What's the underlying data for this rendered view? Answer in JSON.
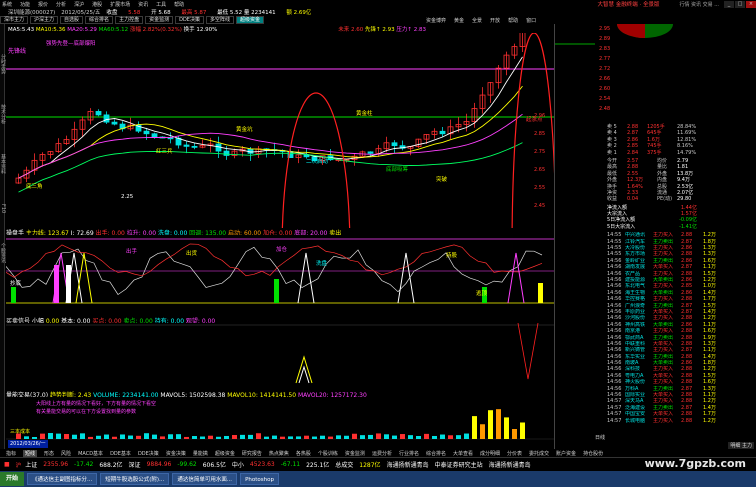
{
  "titlebar": {
    "menu_items": [
      "系统",
      "功能",
      "报价",
      "分析",
      "深沪",
      "港股",
      "扩展市场",
      "资讯",
      "工具",
      "帮助"
    ],
    "title": "大智慧 金融终端 · 全景版",
    "top_right": "行情 资讯 交易 ...",
    "minimize": "_",
    "maximize": "□",
    "close": "×"
  },
  "toolbar": {
    "tabs": [
      "深市主力",
      "沪深主力",
      "自选股",
      "综合排名",
      "主力控盘",
      "资金监测",
      "DDE决策",
      "多空阵线",
      "超级资金"
    ],
    "active_index": 8,
    "right_items": [
      "资金博弈",
      "黄金",
      "全景",
      "开放",
      "帮助",
      "窗口"
    ]
  },
  "lefttabs": [
    "分时走势",
    "技术分析",
    "基本资料",
    "F10",
    "个股资讯"
  ],
  "stock": {
    "code_name": "深圳能源(000027)",
    "date": "2012/05/25/五",
    "line1_parts": [
      {
        "text": "收盘 ",
        "color": "white"
      },
      {
        "text": "5.58",
        "color": "red"
      },
      {
        "text": "  开 5.68 ",
        "color": "white"
      },
      {
        "text": "最高 5.87",
        "color": "red"
      },
      {
        "text": "  最低 5.52  量 2234141  ",
        "color": "white"
      },
      {
        "text": "额 2.69亿",
        "color": "yellow"
      }
    ],
    "line2_parts": [
      {
        "text": "MA5:5.43 ",
        "color": "white"
      },
      {
        "text": "MA10:5.36 ",
        "color": "yellow"
      },
      {
        "text": "MA20:5.29 ",
        "color": "magenta"
      },
      {
        "text": "MA60:5.12 ",
        "color": "green"
      },
      {
        "text": "涨幅 2.82%(0.32%) ",
        "color": "red"
      },
      {
        "text": "换手 12.90%",
        "color": "white"
      }
    ],
    "header_right_parts": [
      {
        "text": "未来 2.60",
        "color": "red"
      },
      {
        "text": "  先锋↑ 2.93",
        "color": "yellow"
      },
      {
        "text": "  压力↑ 2.83",
        "color": "magenta"
      }
    ],
    "line_label_left": "先锋线",
    "price_labels": [
      "2.96",
      "2.85",
      "2.75",
      "2.65",
      "2.55",
      "2.45"
    ],
    "annotations": [
      {
        "text": "强势先登—底部爆阳",
        "color": "magenta"
      },
      {
        "text": "底三角",
        "color": "yellow"
      },
      {
        "text": "红三兵",
        "color": "yellow"
      },
      {
        "text": "黄金坑",
        "color": "yellow"
      },
      {
        "text": "二次启动",
        "color": "cyan"
      },
      {
        "text": "突破",
        "color": "yellow"
      },
      {
        "text": "2.25",
        "color": "white"
      },
      {
        "text": "底部吸筹",
        "color": "green"
      },
      {
        "text": "黄金柱",
        "color": "yellow"
      },
      {
        "text": "起涨点",
        "color": "red"
      }
    ]
  },
  "indicator1": {
    "header_parts": [
      {
        "text": "操盘手 ",
        "color": "white"
      },
      {
        "text": "主力线: 123.67  ",
        "color": "yellow"
      },
      {
        "text": "J: 72.69  ",
        "color": "white"
      },
      {
        "text": "出手: 0.00  ",
        "color": "red"
      },
      {
        "text": "拉升: 0.00  ",
        "color": "magenta"
      },
      {
        "text": "洗盘: 0.00  ",
        "color": "cyan"
      },
      {
        "text": "回调: 135.00  ",
        "color": "green"
      },
      {
        "text": "启动: 60.00  ",
        "color": "orange"
      },
      {
        "text": "加仓: 0.00  ",
        "color": "red"
      },
      {
        "text": "底部: 20.00  ",
        "color": "magenta"
      },
      {
        "text": "卖出",
        "color": "yellow"
      }
    ],
    "labels": [
      {
        "text": "抄底",
        "color": "white"
      },
      {
        "text": "出手",
        "color": "magenta"
      },
      {
        "text": "出货",
        "color": "yellow"
      },
      {
        "text": "加仓",
        "color": "magenta"
      },
      {
        "text": "洗盘",
        "color": "cyan"
      },
      {
        "text": "持股",
        "color": "yellow"
      },
      {
        "text": "逃顶",
        "color": "yellow"
      }
    ]
  },
  "indicator2": {
    "header_parts": [
      {
        "text": "买卖信号 小幅 ",
        "color": "white"
      },
      {
        "text": "0.00 ",
        "color": "yellow"
      },
      {
        "text": "基本: 0.00  ",
        "color": "white"
      },
      {
        "text": "买点: 0.00  ",
        "color": "red"
      },
      {
        "text": "卖点: 0.00  ",
        "color": "green"
      },
      {
        "text": "持有: 0.00  ",
        "color": "cyan"
      },
      {
        "text": "观望: 0.00",
        "color": "magenta"
      }
    ]
  },
  "volume": {
    "header_parts": [
      {
        "text": "量能交易(37,0) ",
        "color": "white"
      },
      {
        "text": "趋势判断: 2.43  ",
        "color": "yellow"
      },
      {
        "text": "VOLUME: 2234141.00  ",
        "color": "cyan"
      },
      {
        "text": "MAVOL5: 1502598.38  ",
        "color": "white"
      },
      {
        "text": "MAVOL10: 1414141.50  ",
        "color": "yellow"
      },
      {
        "text": "MAVOL20: 1257172.30",
        "color": "magenta"
      }
    ],
    "notes": [
      {
        "text": "大阳线上方有量的情况下看好，下方有量的情况下看空",
        "color": "magenta"
      },
      {
        "text": "有关量能交易的可以在下方设置找到量的参数",
        "color": "magenta"
      },
      {
        "text": "三本成本",
        "color": "yellow"
      }
    ],
    "date_label": "2012/03/26/一"
  },
  "rightpanel": {
    "top_price_labels": [
      "2.95",
      "2.89",
      "2.83",
      "2.77",
      "2.72",
      "2.66",
      "2.60",
      "2.54",
      "2.48"
    ],
    "order_book": [
      {
        "side": "卖 5",
        "price": "2.88",
        "vol": "1205手",
        "pct": "28.84%"
      },
      {
        "side": "卖 4",
        "price": "2.87",
        "vol": "645手",
        "pct": "11.69%"
      },
      {
        "side": "卖 3",
        "price": "2.86",
        "vol": "1.6万",
        "pct": "12.81%"
      },
      {
        "side": "卖 2",
        "price": "2.85",
        "vol": "745手",
        "pct": "8.16%"
      },
      {
        "side": "卖 1",
        "price": "2.84",
        "vol": "375手",
        "pct": "14.79%"
      }
    ],
    "stats": [
      {
        "label": "今开",
        "value": "2.57",
        "label2": "均价",
        "value2": "2.79"
      },
      {
        "label": "最高",
        "value": "2.88",
        "label2": "量比",
        "value2": "1.81"
      },
      {
        "label": "最低",
        "value": "2.55",
        "label2": "外盘",
        "value2": "13.8万"
      },
      {
        "label": "外盘",
        "value": "12.3万",
        "label2": "内盘",
        "value2": "9.4万"
      },
      {
        "label": "换手",
        "value": "1.64%",
        "label2": "总股",
        "value2": "2.53亿"
      },
      {
        "label": "净资",
        "value": "2.33",
        "label2": "流通",
        "value2": "2.07亿"
      },
      {
        "label": "收益",
        "value": "0.04",
        "label2": "PE(动)",
        "value2": "29.80"
      }
    ],
    "flows": [
      {
        "label": "净流入额",
        "value": "1.44亿"
      },
      {
        "label": "大宗流入",
        "value": "1.57亿"
      },
      {
        "label": "5日净流入额",
        "value": "-0.09亿"
      },
      {
        "label": "5日大宗流入",
        "value": "-1.41亿"
      }
    ],
    "ticks": [
      {
        "time": "14:55",
        "name": "中兴通讯",
        "act": "主力买入",
        "price": "2.88",
        "vol": "1.2万"
      },
      {
        "time": "14:55",
        "name": "江铃汽车",
        "act": "主力卖出",
        "price": "2.87",
        "vol": "1.8万"
      },
      {
        "time": "14:55",
        "name": "大冷股份",
        "act": "主力买入",
        "price": "2.86",
        "vol": "1.3万"
      },
      {
        "time": "14:55",
        "name": "东方市场",
        "act": "主力买入",
        "price": "2.88",
        "vol": "1.3万"
      },
      {
        "time": "14:56",
        "name": "金岭矿业",
        "act": "主力卖出",
        "price": "2.86",
        "vol": "1.6万"
      },
      {
        "time": "14:56",
        "name": "湖南发展",
        "act": "大单买入",
        "price": "2.87",
        "vol": "1.1万"
      },
      {
        "time": "14:56",
        "name": "农产品",
        "act": "主力买入",
        "price": "2.88",
        "vol": "1.5万"
      },
      {
        "time": "14:56",
        "name": "建投能源",
        "act": "大单卖出",
        "price": "2.86",
        "vol": "1.2万"
      },
      {
        "time": "14:56",
        "name": "东北电气",
        "act": "主力买入",
        "price": "2.85",
        "vol": "1.0万"
      },
      {
        "time": "14:56",
        "name": "海王生物",
        "act": "大单卖出",
        "price": "2.86",
        "vol": "1.4万"
      },
      {
        "time": "14:56",
        "name": "华控赛格",
        "act": "主力买入",
        "price": "2.88",
        "vol": "1.7万"
      },
      {
        "time": "14:56",
        "name": "广州浪奇",
        "act": "主力卖出",
        "price": "2.87",
        "vol": "1.5万"
      },
      {
        "time": "14:56",
        "name": "丰原药业",
        "act": "大单买入",
        "price": "2.87",
        "vol": "1.4万"
      },
      {
        "time": "14:56",
        "name": "沙河股份",
        "act": "主力买入",
        "price": "2.88",
        "vol": "1.2万"
      },
      {
        "time": "14:56",
        "name": "神州高铁",
        "act": "大单卖出",
        "price": "2.86",
        "vol": "1.1万"
      },
      {
        "time": "14:56",
        "name": "南京港",
        "act": "主力买入",
        "price": "2.88",
        "vol": "1.6万"
      },
      {
        "time": "14:56",
        "name": "鄂武商A",
        "act": "主力卖出",
        "price": "2.88",
        "vol": "1.9万"
      },
      {
        "time": "14:56",
        "name": "中联重科",
        "act": "大单买入",
        "price": "2.88",
        "vol": "1.3万"
      },
      {
        "time": "14:56",
        "name": "新兴铸管",
        "act": "主力买入",
        "price": "2.87",
        "vol": "1.1万"
      },
      {
        "time": "14:56",
        "name": "东华实业",
        "act": "主力卖出",
        "price": "2.88",
        "vol": "1.4万"
      },
      {
        "time": "14:56",
        "name": "南玻A",
        "act": "大单卖出",
        "price": "2.86",
        "vol": "1.8万"
      },
      {
        "time": "14:56",
        "name": "深科技",
        "act": "主力买入",
        "price": "2.88",
        "vol": "1.2万"
      },
      {
        "time": "14:56",
        "name": "粤电力A",
        "act": "大单买入",
        "price": "2.88",
        "vol": "1.5万"
      },
      {
        "time": "14:56",
        "name": "神火股份",
        "act": "主力买入",
        "price": "2.88",
        "vol": "1.6万"
      },
      {
        "time": "14:56",
        "name": "万科A",
        "act": "主力卖出",
        "price": "2.87",
        "vol": "1.3万"
      },
      {
        "time": "14:56",
        "name": "国际实业",
        "act": "大单买入",
        "price": "2.88",
        "vol": "1.1万"
      },
      {
        "time": "14:57",
        "name": "深天马A",
        "act": "主力买入",
        "price": "2.88",
        "vol": "1.2万"
      },
      {
        "time": "14:57",
        "name": "泛海建设",
        "act": "主力卖出",
        "price": "2.87",
        "vol": "1.4万"
      },
      {
        "time": "14:57",
        "name": "中国宝安",
        "act": "大单买入",
        "price": "2.88",
        "vol": "1.7万"
      },
      {
        "time": "14:57",
        "name": "长城电脑",
        "act": "主力买入",
        "price": "2.88",
        "vol": "1.2万"
      }
    ],
    "ticks_footer": "日线",
    "tab_label": "明细 主力"
  },
  "bottom_tabs": {
    "items": [
      "指标",
      "短线",
      "形态",
      "风险",
      "MACD基本",
      "DDE基本",
      "DDE决策",
      "资金决策",
      "量能擒",
      "超级资金",
      "研究报告",
      "热点聚焦",
      "各热股",
      "个股训练",
      "资金监测",
      "运费分析",
      "行业排名",
      "综合排名",
      "大单查看",
      "成分明细",
      "分价表",
      "委托成交",
      "账户资金",
      "持仓股份"
    ],
    "active_index": 1
  },
  "statusbar": {
    "items": [
      {
        "text": "上证",
        "color": "white"
      },
      {
        "text": "2355.96",
        "color": "red"
      },
      {
        "text": "-17.42",
        "color": "green"
      },
      {
        "text": "688.2亿",
        "color": "white"
      },
      {
        "text": "深证",
        "color": "white"
      },
      {
        "text": "9884.96",
        "color": "red"
      },
      {
        "text": "-99.62",
        "color": "green"
      },
      {
        "text": "606.5亿",
        "color": "white"
      },
      {
        "text": "中小",
        "color": "white"
      },
      {
        "text": "4523.63",
        "color": "red"
      },
      {
        "text": "-67.11",
        "color": "green"
      },
      {
        "text": "225.1亿",
        "color": "white"
      },
      {
        "text": "总成交",
        "color": "white"
      },
      {
        "text": "1287亿",
        "color": "yellow"
      },
      {
        "text": "海通扬新通青岛",
        "color": "white"
      },
      {
        "text": "中泰证券研究主站",
        "color": "white"
      },
      {
        "text": "海通扬新通青岛",
        "color": "white"
      }
    ]
  },
  "taskbar": {
    "start_label": "开始",
    "tasks": [
      "《通达信主副图指标分...",
      "短期牛股选股公式(附)...",
      "通达信简单可用水面...",
      "Photoshop"
    ]
  },
  "watermark": "www.7gpzb.com",
  "colors": {
    "background": "#000000",
    "up": "#ff3030",
    "down": "#00e000",
    "ma10": "#ffff00",
    "ma20": "#ff40ff",
    "ma5": "#ffffff"
  }
}
